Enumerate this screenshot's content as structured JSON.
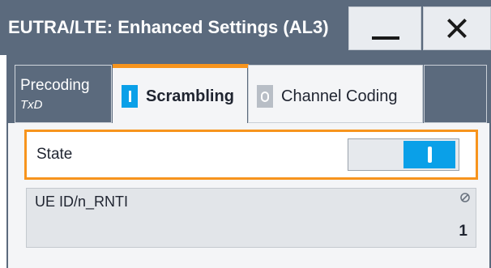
{
  "window": {
    "title": "EUTRA/LTE: Enhanced Settings (AL3)",
    "minimize_icon": "minimize-icon",
    "close_icon": "close-icon"
  },
  "tabs": [
    {
      "label": "Precoding",
      "sublabel": "TxD",
      "active": false
    },
    {
      "label": "Scrambling",
      "indicator": "on",
      "active": true
    },
    {
      "label": "Channel Coding",
      "indicator": "off",
      "active": false
    }
  ],
  "colors": {
    "header_bg": "#5b6a7d",
    "accent": "#f7941d",
    "toggle_on": "#0aa0e8",
    "panel_bg": "#f4f5f7"
  },
  "state": {
    "label": "State",
    "value": "on"
  },
  "ue_id": {
    "label": "UE ID/n_RNTI",
    "value": "1",
    "icon": "readonly-icon"
  }
}
